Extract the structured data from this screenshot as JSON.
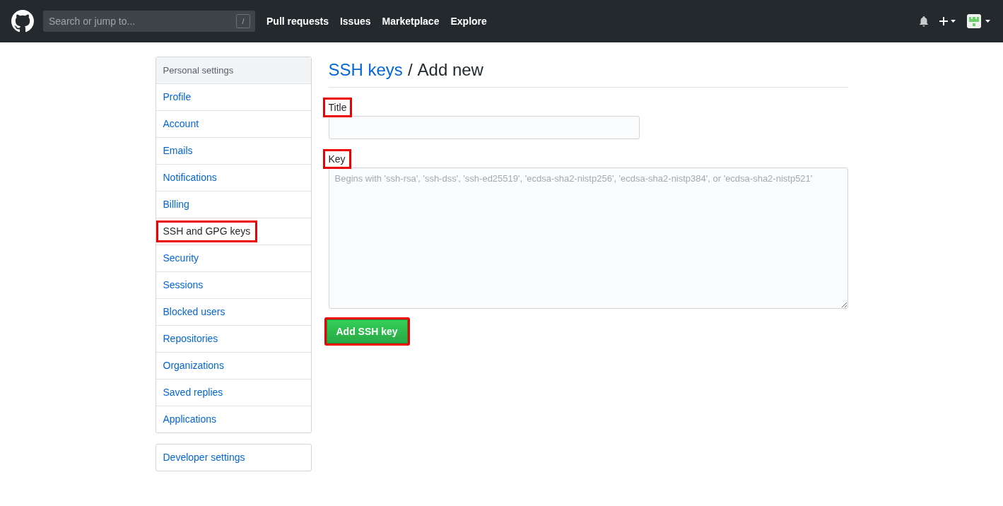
{
  "header": {
    "search": {
      "placeholder": "Search or jump to...",
      "shortcut": "/"
    },
    "nav": [
      "Pull requests",
      "Issues",
      "Marketplace",
      "Explore"
    ]
  },
  "sidebar": {
    "heading": "Personal settings",
    "items": [
      {
        "label": "Profile",
        "selected": false,
        "highlighted": false
      },
      {
        "label": "Account",
        "selected": false,
        "highlighted": false
      },
      {
        "label": "Emails",
        "selected": false,
        "highlighted": false
      },
      {
        "label": "Notifications",
        "selected": false,
        "highlighted": false
      },
      {
        "label": "Billing",
        "selected": false,
        "highlighted": false
      },
      {
        "label": "SSH and GPG keys",
        "selected": true,
        "highlighted": true
      },
      {
        "label": "Security",
        "selected": false,
        "highlighted": false
      },
      {
        "label": "Sessions",
        "selected": false,
        "highlighted": false
      },
      {
        "label": "Blocked users",
        "selected": false,
        "highlighted": false
      },
      {
        "label": "Repositories",
        "selected": false,
        "highlighted": false
      },
      {
        "label": "Organizations",
        "selected": false,
        "highlighted": false
      },
      {
        "label": "Saved replies",
        "selected": false,
        "highlighted": false
      },
      {
        "label": "Applications",
        "selected": false,
        "highlighted": false
      }
    ],
    "developer": "Developer settings"
  },
  "main": {
    "breadcrumb_link": "SSH keys",
    "separator": "/",
    "heading": "Add new",
    "fields": [
      {
        "kind": "input",
        "label": "Title",
        "highlighted": true
      },
      {
        "kind": "textarea",
        "label": "Key",
        "highlighted": true,
        "placeholder": "Begins with 'ssh-rsa', 'ssh-dss', 'ssh-ed25519', 'ecdsa-sha2-nistp256', 'ecdsa-sha2-nistp384', or 'ecdsa-sha2-nistp521'"
      }
    ],
    "submit": {
      "label": "Add SSH key",
      "highlighted": true
    }
  }
}
